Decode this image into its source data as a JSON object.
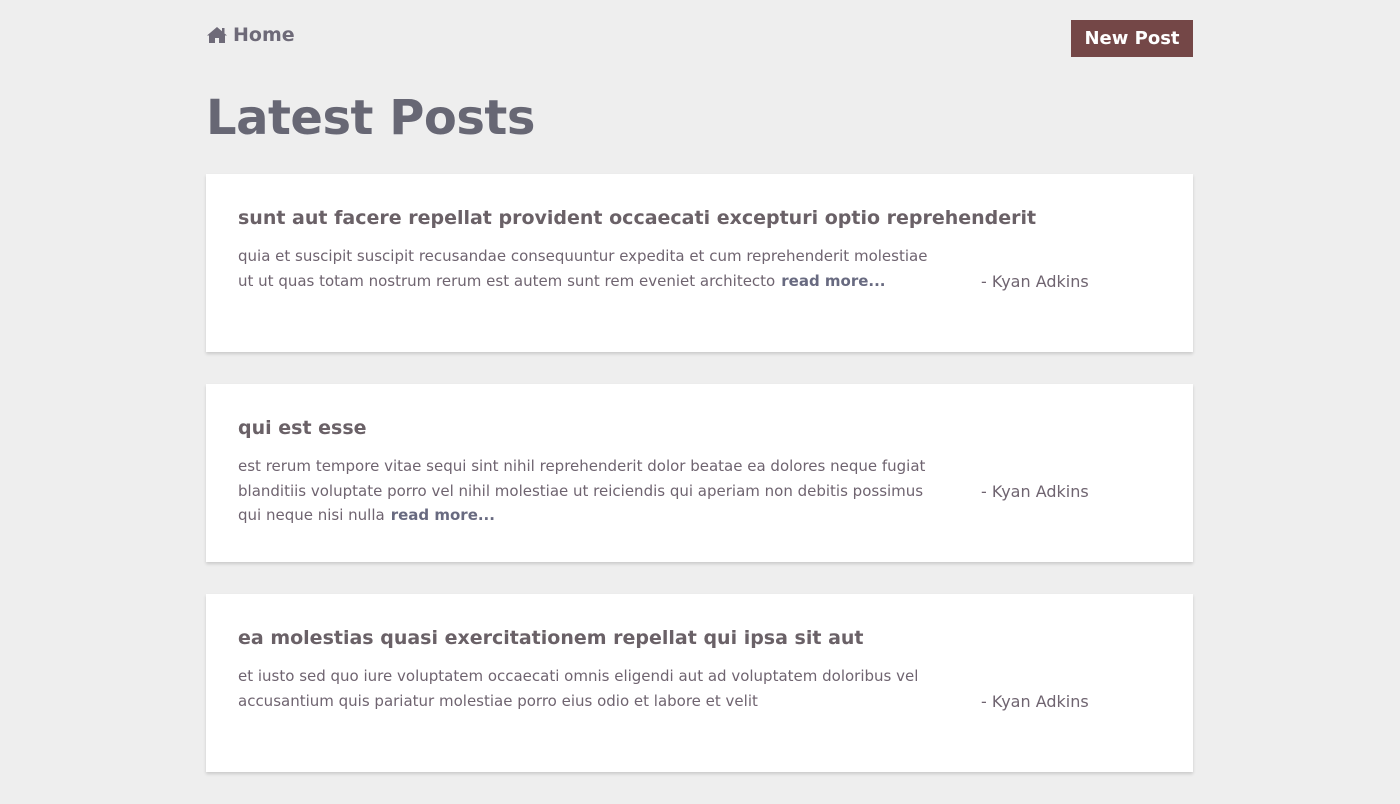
{
  "nav": {
    "home_label": "Home",
    "home_icon": "home-icon",
    "new_post_label": "New Post"
  },
  "colors": {
    "page_background": "#eeeeee",
    "accent_button": "#744747",
    "card_background": "#ffffff",
    "title_text": "#676774"
  },
  "page_title": "Latest Posts",
  "posts": [
    {
      "title": "sunt aut facere repellat provident occaecati excepturi optio reprehenderit",
      "body": "quia et suscipit suscipit recusandae consequuntur expedita et cum reprehenderit molestiae ut ut quas totam nostrum rerum est autem sunt rem eveniet architecto",
      "read_more": "read more...",
      "author": "- Kyan Adkins"
    },
    {
      "title": "qui est esse",
      "body": "est rerum tempore vitae sequi sint nihil reprehenderit dolor beatae ea dolores neque fugiat blanditiis voluptate porro vel nihil molestiae ut reiciendis qui aperiam non debitis possimus qui neque nisi nulla",
      "read_more": "read more...",
      "author": "- Kyan Adkins"
    },
    {
      "title": "ea molestias quasi exercitationem repellat qui ipsa sit aut",
      "body": "et iusto sed quo iure voluptatem occaecati omnis eligendi aut ad voluptatem doloribus vel accusantium quis pariatur molestiae porro eius odio et labore et velit",
      "read_more": "",
      "author": "- Kyan Adkins"
    }
  ]
}
